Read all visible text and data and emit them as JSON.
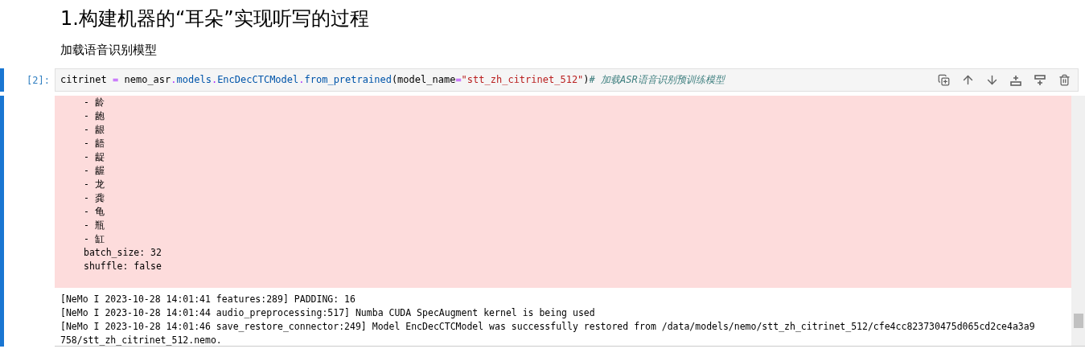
{
  "heading": "1.构建机器的“耳朵”实现听写的过程",
  "subheading": "加载语音识别模型",
  "code_cell": {
    "prompt": "[2]:",
    "selected": true,
    "tokens": [
      {
        "kind": "plain",
        "text": "citrinet "
      },
      {
        "kind": "operator",
        "text": "="
      },
      {
        "kind": "plain",
        "text": " nemo_asr"
      },
      {
        "kind": "operator",
        "text": "."
      },
      {
        "kind": "attr",
        "text": "models"
      },
      {
        "kind": "operator",
        "text": "."
      },
      {
        "kind": "attr",
        "text": "EncDecCTCModel"
      },
      {
        "kind": "operator",
        "text": "."
      },
      {
        "kind": "attr",
        "text": "from_pretrained"
      },
      {
        "kind": "plain",
        "text": "(model_name"
      },
      {
        "kind": "operator",
        "text": "="
      },
      {
        "kind": "string",
        "text": "\"stt_zh_citrinet_512\""
      },
      {
        "kind": "plain",
        "text": ")"
      },
      {
        "kind": "comment",
        "text": "# 加载ASR语音识别预训练模型"
      }
    ]
  },
  "output": {
    "stderr_lines": [
      "- 龄",
      "- 龅",
      "- 龈",
      "- 龉",
      "- 龊",
      "- 龌",
      "- 龙",
      "- 龚",
      "- 龟",
      "- 瓶",
      "- 缸",
      "batch_size: 32",
      "shuffle: false"
    ],
    "log_lines": [
      "[NeMo I 2023-10-28 14:01:41 features:289] PADDING: 16",
      "[NeMo I 2023-10-28 14:01:44 audio_preprocessing:517] Numba CUDA SpecAugment kernel is being used",
      "[NeMo I 2023-10-28 14:01:46 save_restore_connector:249] Model EncDecCTCModel was successfully restored from /data/models/nemo/stt_zh_citrinet_512/cfe4cc823730475d065cd2ce4a3a9",
      "758/stt_zh_citrinet_512.nemo."
    ]
  }
}
